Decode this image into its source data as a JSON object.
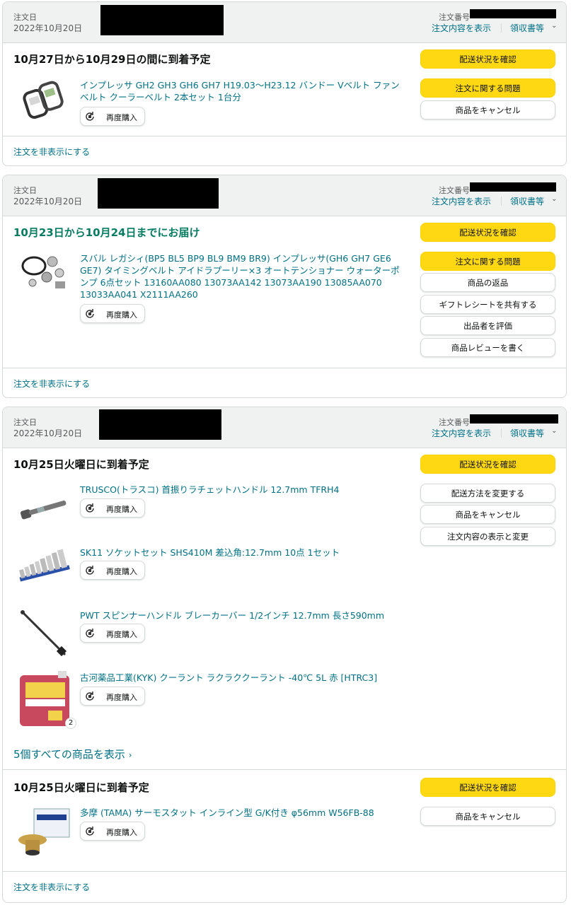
{
  "orders": [
    {
      "order_date_label": "注文日",
      "order_date": "2022年10月20日",
      "order_number_label": "注文番号",
      "details_link": "注文内容を表示",
      "receipt_link": "領収書等",
      "hide_link": "注文を非表示にする",
      "shipments": [
        {
          "status": "10月27日から10月29日の間に到着予定",
          "actions": [
            "配送状況を確認",
            "注文に関する問題",
            "商品をキャンセル"
          ],
          "items": [
            {
              "title": "インプレッサ GH2 GH3 GH6 GH7 H19.03～H23.12 バンドー Vベルト ファンベルト クーラーベルト 2本セット 1台分",
              "buy_again": "再度購入",
              "icon": "v-belt-product-image"
            }
          ]
        }
      ]
    },
    {
      "order_date_label": "注文日",
      "order_date": "2022年10月20日",
      "order_number_label": "注文番号",
      "details_link": "注文内容を表示",
      "receipt_link": "領収書等",
      "hide_link": "注文を非表示にする",
      "shipments": [
        {
          "status": "10月23日から10月24日までにお届け",
          "actions": [
            "配送状況を確認",
            "注文に関する問題",
            "商品の返品",
            "ギフトレシートを共有する",
            "出品者を評価",
            "商品レビューを書く"
          ],
          "items": [
            {
              "title": "スバル レガシィ(BP5 BL5 BP9 BL9 BM9 BR9) インプレッサ(GH6 GH7 GE6 GE7) タイミングベルト アイドラプーリー×3 オートテンショナー ウォーターポンプ 6点セット 13160AA080 13073AA142 13073AA190 13085AA070 13033AA041 X2111AA260",
              "buy_again": "再度購入",
              "icon": "timing-belt-kit-product-image"
            }
          ]
        }
      ]
    },
    {
      "order_date_label": "注文日",
      "order_date": "2022年10月20日",
      "order_number_label": "注文番号",
      "details_link": "注文内容を表示",
      "receipt_link": "領収書等",
      "hide_link": "注文を非表示にする",
      "show_all": "5個すべての商品を表示",
      "shipments": [
        {
          "status": "10月25日火曜日に到着予定",
          "actions": [
            "配送状況を確認",
            "配送方法を変更する",
            "商品をキャンセル",
            "注文内容の表示と変更"
          ],
          "items": [
            {
              "title": "TRUSCO(トラスコ) 首振りラチェットハンドル 12.7mm TFRH4",
              "buy_again": "再度購入",
              "icon": "ratchet-handle-product-image"
            },
            {
              "title": "SK11 ソケットセット SHS410M 差込角:12.7mm 10点 1セット",
              "buy_again": "再度購入",
              "icon": "socket-set-product-image"
            },
            {
              "title": "PWT スピンナーハンドル ブレーカーバー 1/2インチ 12.7mm 長さ590mm",
              "buy_again": "再度購入",
              "icon": "breaker-bar-product-image"
            },
            {
              "title": "古河薬品工業(KYK) クーラント ラクラククーラント -40℃ 5L 赤 [HTRC3]",
              "buy_again": "再度購入",
              "icon": "coolant-jug-product-image",
              "quantity": "2"
            }
          ]
        },
        {
          "status": "10月25日火曜日に到着予定",
          "actions": [
            "配送状況を確認",
            "商品をキャンセル"
          ],
          "items": [
            {
              "title": "多摩 (TAMA) サーモスタット インライン型 G/K付き φ56mm W56FB-88",
              "buy_again": "再度購入",
              "icon": "thermostat-product-image"
            }
          ]
        }
      ]
    }
  ],
  "colors": {
    "link": "#007185",
    "button_yellow": "#ffd814",
    "header_bg": "#f0f2f2",
    "status_green": "#067d62"
  }
}
